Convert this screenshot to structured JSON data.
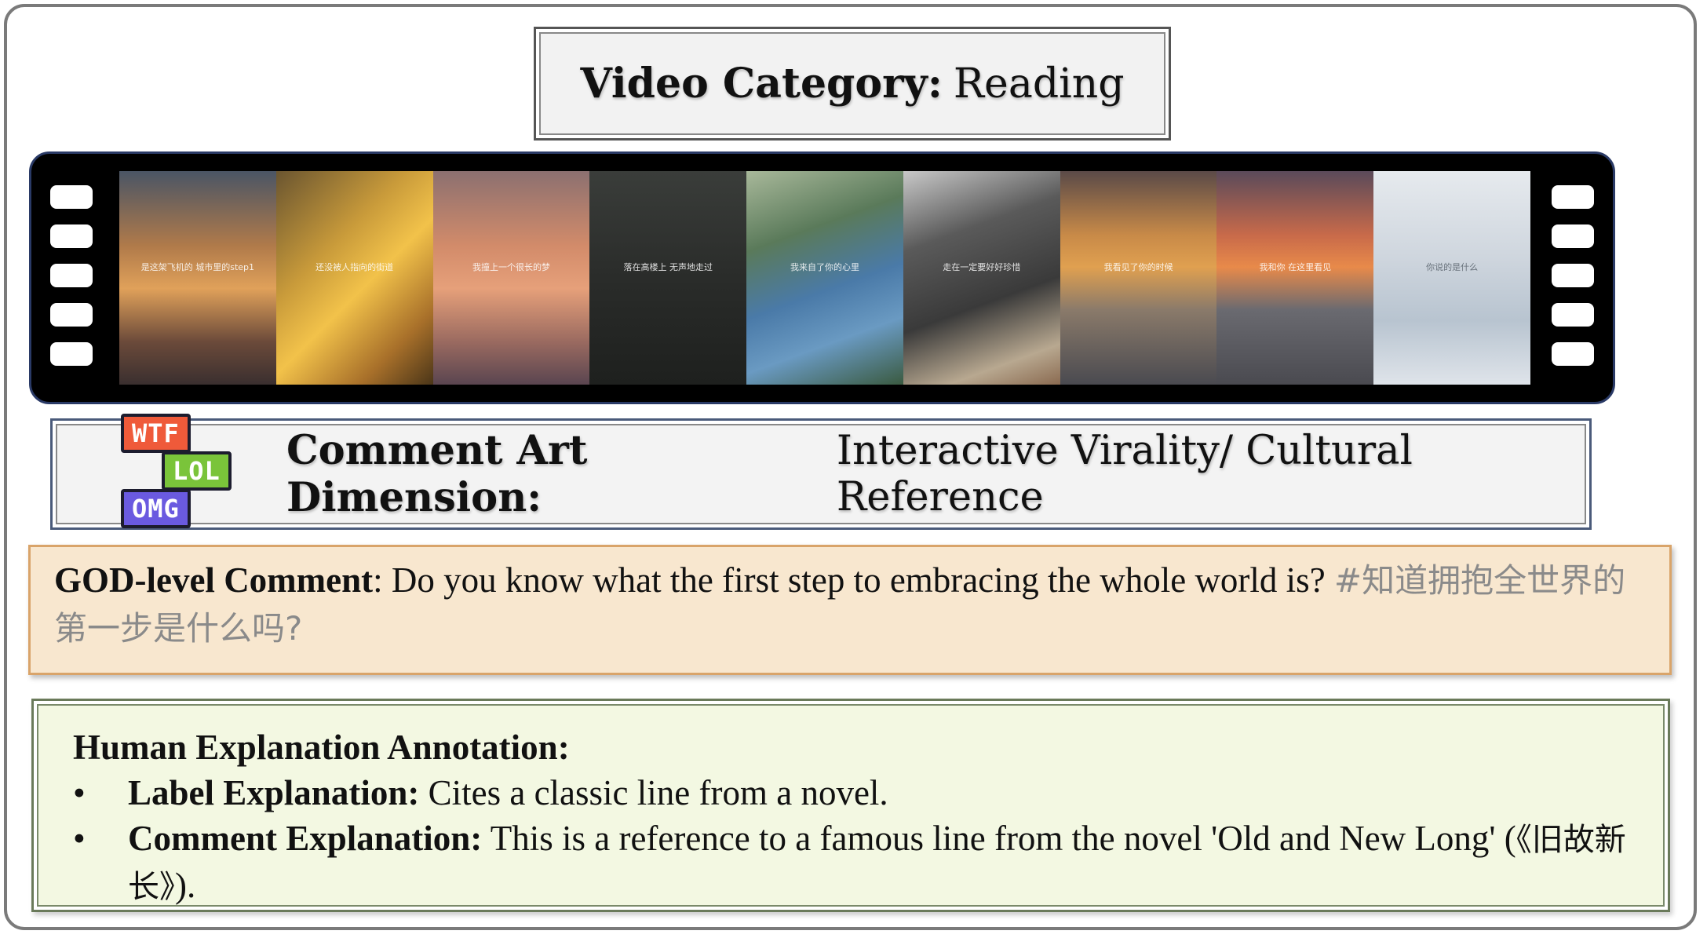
{
  "video_category": {
    "label": "Video Category:",
    "value": "Reading"
  },
  "film_frames": [
    {
      "caption": "是这架飞机的 城市里的step1"
    },
    {
      "caption": "还没被人指向的街道"
    },
    {
      "caption": "我撞上一个很长的梦"
    },
    {
      "caption": "落在高楼上 无声地走过"
    },
    {
      "caption": "我来自了你的心里"
    },
    {
      "caption": "走在一定要好好珍惜"
    },
    {
      "caption": "我看见了你的时候"
    },
    {
      "caption": "我和你 在这里看见"
    },
    {
      "caption": "你说的是什么"
    }
  ],
  "stickers": [
    "WTF",
    "LOL",
    "OMG"
  ],
  "comment_art": {
    "label": "Comment Art Dimension:",
    "value": "Interactive Virality/ Cultural Reference"
  },
  "god_comment": {
    "label": "GOD-level Comment",
    "text": ": Do you know what the first step to embracing the whole world is? ",
    "chinese": "#知道拥抱全世界的第一步是什么吗?"
  },
  "explanation": {
    "title": "Human Explanation Annotation:",
    "bullet": "•",
    "items": [
      {
        "label": "Label Explanation:",
        "text": " Cites a classic line from a novel."
      },
      {
        "label": "Comment Explanation:",
        "text": " This is a reference to a famous line from the novel 'Old and New Long' (",
        "chinese": "《旧故新长》",
        "tail": ")."
      }
    ]
  }
}
